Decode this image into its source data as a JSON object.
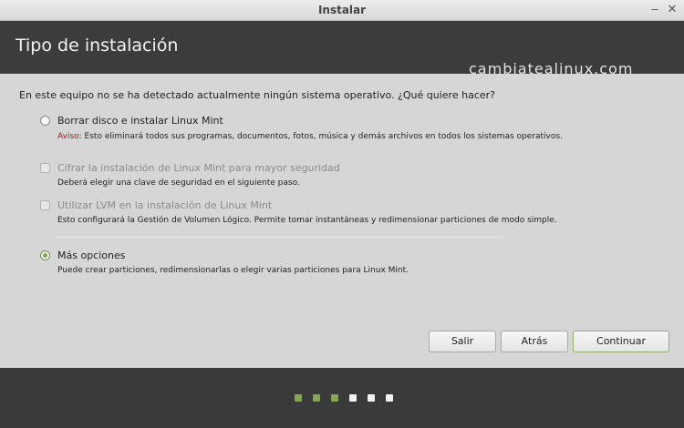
{
  "window": {
    "title": "Instalar",
    "minimize_glyph": "‒",
    "close_glyph": "✕"
  },
  "header": {
    "title": "Tipo de instalación"
  },
  "watermark": "cambiatealinux.com",
  "question": "En este equipo no se ha detectado actualmente ningún sistema operativo. ¿Qué quiere hacer?",
  "options": [
    {
      "type": "radio",
      "label": "Borrar disco e instalar Linux Mint",
      "warning_prefix": "Aviso:",
      "description": " Esto eliminará todos sus programas, documentos, fotos, música y demás archivos en todos los sistemas operativos.",
      "selected": false,
      "enabled": true
    },
    {
      "type": "checkbox",
      "label": "Cifrar la instalación de Linux Mint para mayor seguridad",
      "description": "Deberá elegir una clave de seguridad en el siguiente paso.",
      "checked": false,
      "enabled": false
    },
    {
      "type": "checkbox",
      "label": "Utilizar LVM en la instalación de Linux Mint",
      "description": "Esto configurará la Gestión de Volumen Lógico. Permite tomar instantáneas y redimensionar particiones de modo simple.",
      "checked": false,
      "enabled": false
    },
    {
      "type": "radio",
      "label": "Más opciones",
      "description": "Puede crear particiones, redimensionarlas o elegir varias particiones para Linux Mint.",
      "selected": true,
      "enabled": true
    }
  ],
  "buttons": {
    "quit": "Salir",
    "back": "Atrás",
    "continue": "Continuar"
  },
  "progress": {
    "total_steps": 6,
    "completed_steps": 3
  },
  "colors": {
    "accent": "#87a556",
    "warning": "#a01818",
    "dot_done": "#87a556",
    "dot_pending": "#f2f2f2"
  }
}
